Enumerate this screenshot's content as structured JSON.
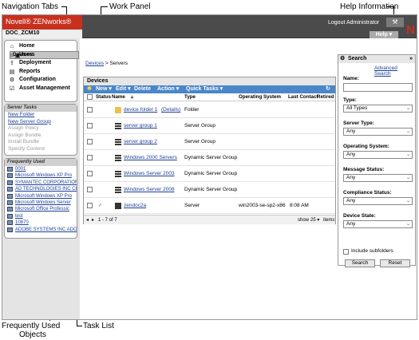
{
  "callouts": {
    "navigation_tabs": "Navigation Tabs",
    "work_panel": "Work Panel",
    "help_information": "Help Information",
    "frequently_used": "Frequently Used",
    "frequently_used_2": "Objects",
    "task_list": "Task List"
  },
  "header": {
    "brand": "Novell® ZENworks®",
    "zone": "DOC_ZCM10",
    "logout": "Logout Administrator",
    "help": "Help ▾",
    "wrench": "⚒",
    "n_logo": "N"
  },
  "nav": [
    {
      "label": "Home",
      "icon": "⌂"
    },
    {
      "label": "Devices",
      "icon": "▣",
      "selected": true
    },
    {
      "label": "Users",
      "icon": "☺"
    },
    {
      "label": "Deployment",
      "icon": "⇪"
    },
    {
      "label": "Reports",
      "icon": "▤"
    },
    {
      "label": "Configuration",
      "icon": "⚙"
    },
    {
      "label": "Asset Management",
      "icon": "☑"
    }
  ],
  "tasks": {
    "title": "Server Tasks",
    "items": [
      {
        "label": "New Folder",
        "enabled": true
      },
      {
        "label": "New Server Group",
        "enabled": true
      },
      {
        "label": "Assign Policy",
        "enabled": false
      },
      {
        "label": "Assign Bundle",
        "enabled": false
      },
      {
        "label": "Install Bundle",
        "enabled": false
      },
      {
        "label": "Specify Content",
        "enabled": false
      }
    ]
  },
  "frequent": {
    "title": "Frequently Used",
    "items": [
      "0001",
      "Microsoft Windows XP Pro",
      "SYMANTEC CORPORATION",
      "AD TECHNOLOGIES INC CE",
      "Microsoft Windows XP Pro",
      "Microsoft Windows Server",
      "Microsoft Office Professic",
      "test",
      "10870",
      "ADOBE SYSTEMS INC ADO!"
    ]
  },
  "breadcrumb": {
    "link": "Devices",
    "sep": " > ",
    "current": "Servers"
  },
  "devices": {
    "title": "Devices",
    "toolbar": [
      "New ▾",
      "Edit ▾",
      "Delete",
      "Action ▾",
      "Quick Tasks ▾"
    ],
    "columns": [
      "Status",
      "Name",
      "Type",
      "Operating System",
      "Last Contact",
      "Retired"
    ],
    "sort_marker": "▵",
    "rows": [
      {
        "name": "device folder 1",
        "extra": "(Details)",
        "type": "Folder",
        "os": "",
        "contact": "",
        "icon": "folder"
      },
      {
        "name": "server group 1",
        "extra": "",
        "type": "Server Group",
        "os": "",
        "contact": "",
        "icon": "group"
      },
      {
        "name": "server group 2",
        "extra": "",
        "type": "Server Group",
        "os": "",
        "contact": "",
        "icon": "group"
      },
      {
        "name": "Windows 2000 Servers",
        "extra": "",
        "type": "Dynamic Server Group",
        "os": "",
        "contact": "",
        "icon": "dyngroup"
      },
      {
        "name": "Windows Server 2003",
        "extra": "",
        "type": "Dynamic Server Group",
        "os": "",
        "contact": "",
        "icon": "dyngroup"
      },
      {
        "name": "Windows Server 2008",
        "extra": "",
        "type": "Dynamic Server Group",
        "os": "",
        "contact": "",
        "icon": "dyngroup"
      },
      {
        "name": "zendoc2a",
        "extra": "",
        "type": "Server",
        "os": "win2003-se-sp2-x86",
        "contact": "8:08 AM",
        "icon": "server"
      }
    ],
    "pager": {
      "range": "1 - 7 of 7",
      "show": "show",
      "count": "25 ▾",
      "items": "items"
    }
  },
  "search": {
    "title": "Search",
    "advanced": "Advanced Search",
    "name_label": "Name:",
    "name_value": "",
    "fields": [
      {
        "label": "Type:",
        "value": "All Types"
      },
      {
        "label": "Server Type:",
        "value": "Any"
      },
      {
        "label": "Operating System:",
        "value": "Any"
      },
      {
        "label": "Message Status:",
        "value": "Any"
      },
      {
        "label": "Compliance Status:",
        "value": "Any"
      },
      {
        "label": "Device State:",
        "value": "Any"
      }
    ],
    "include_sub": "Include subfolders",
    "search_btn": "Search",
    "reset_btn": "Reset"
  },
  "colors": {
    "brand_red": "#c8301e",
    "toolbar_blue": "#4a86c8",
    "link_blue": "#1c3f94"
  }
}
